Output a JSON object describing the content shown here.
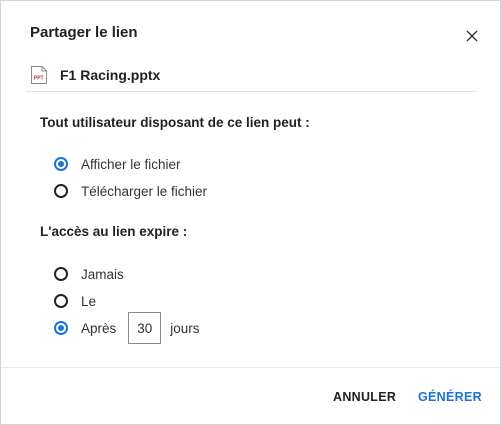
{
  "dialog": {
    "title": "Partager le lien",
    "file": {
      "icon": "pptx-file-icon",
      "icon_text": "PPT",
      "name": "F1 Racing.pptx"
    },
    "permission": {
      "label": "Tout utilisateur disposant de ce lien peut :",
      "options": [
        {
          "label": "Afficher le fichier",
          "checked": true
        },
        {
          "label": "Télécharger le fichier",
          "checked": false
        }
      ]
    },
    "expiry": {
      "label": "L'accès au lien expire :",
      "options": [
        {
          "label": "Jamais",
          "checked": false
        },
        {
          "label": "Le",
          "checked": false
        },
        {
          "label": "Après",
          "checked": true
        }
      ],
      "days_value": "30",
      "days_unit": "jours"
    },
    "buttons": {
      "cancel": "ANNULER",
      "generate": "GÉNÉRER"
    }
  },
  "colors": {
    "accent": "#1a73d9",
    "text": "#222222",
    "file_icon": "#c0392b"
  }
}
